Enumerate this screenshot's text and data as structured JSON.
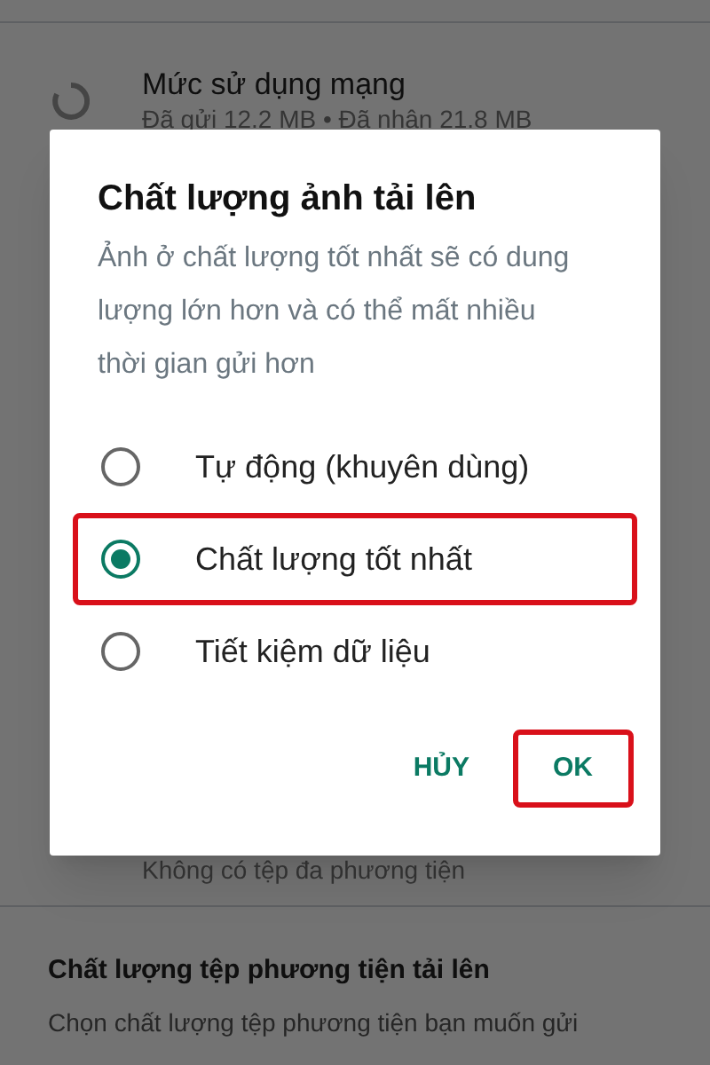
{
  "background": {
    "network_usage": {
      "title": "Mức sử dụng mạng",
      "subtitle": "Đã gửi 12.2 MB • Đã nhận 21.8 MB"
    },
    "media_note": "Không có tệp đa phương tiện",
    "upload_quality": {
      "title": "Chất lượng tệp phương tiện tải lên",
      "subtitle": "Chọn chất lượng tệp phương tiện bạn muốn gửi"
    }
  },
  "dialog": {
    "title": "Chất lượng ảnh tải lên",
    "message": "Ảnh ở chất lượng tốt nhất sẽ có dung lượng lớn hơn và có thể mất nhiều thời gian gửi hơn",
    "options": [
      {
        "label": "Tự động (khuyên dùng)",
        "selected": false,
        "highlighted": false
      },
      {
        "label": "Chất lượng tốt nhất",
        "selected": true,
        "highlighted": true
      },
      {
        "label": "Tiết kiệm dữ liệu",
        "selected": false,
        "highlighted": false
      }
    ],
    "buttons": [
      {
        "label": "HỦY",
        "highlighted": false
      },
      {
        "label": "OK",
        "highlighted": true
      }
    ]
  }
}
